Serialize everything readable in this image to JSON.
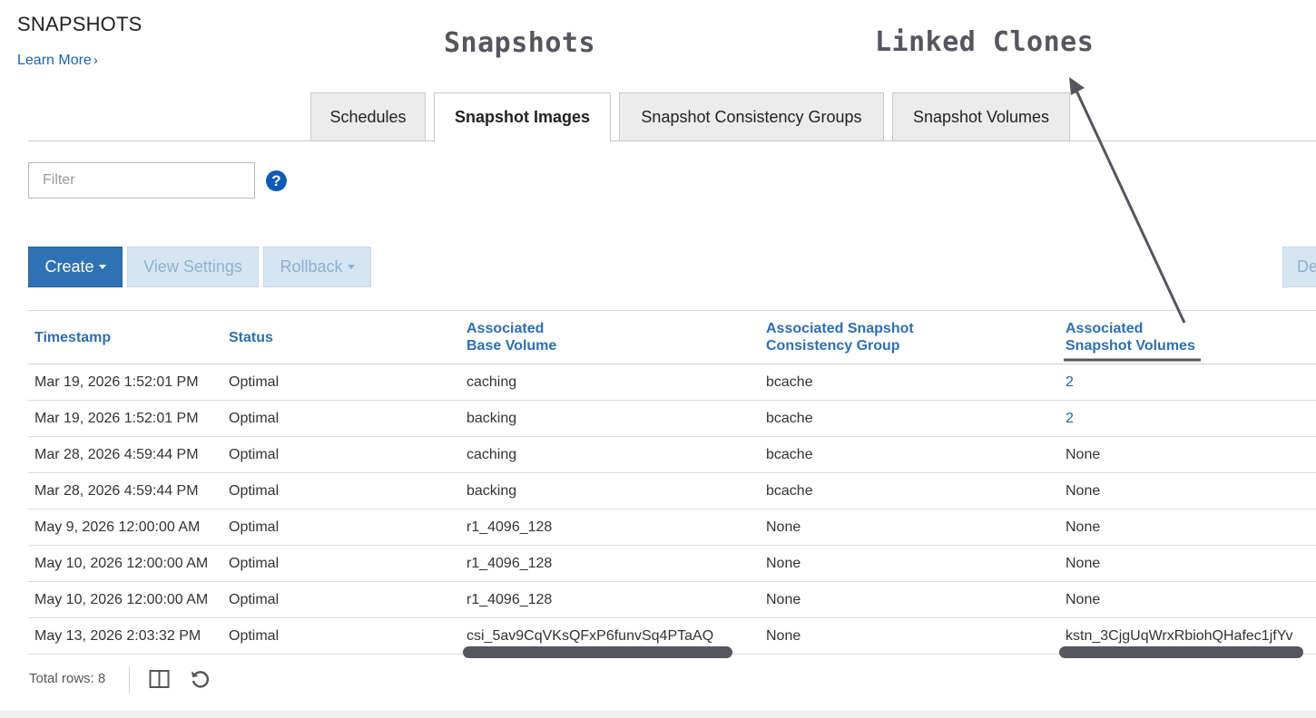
{
  "page": {
    "title": "SNAPSHOTS",
    "learn_more": "Learn More",
    "learn_more_chevron": "›"
  },
  "annotations": {
    "snapshots": "Snapshots",
    "linked_clones": "Linked Clones"
  },
  "tabs": [
    {
      "label": "Schedules",
      "active": false
    },
    {
      "label": "Snapshot Images",
      "active": true
    },
    {
      "label": "Snapshot Consistency Groups",
      "active": false
    },
    {
      "label": "Snapshot Volumes",
      "active": false
    }
  ],
  "filter": {
    "placeholder": "Filter",
    "help_icon": "?"
  },
  "toolbar": {
    "create": "Create",
    "view_settings": "View Settings",
    "rollback": "Rollback",
    "delete_partial": "De"
  },
  "table": {
    "columns": [
      {
        "line1": "Timestamp",
        "line2": ""
      },
      {
        "line1": "Status",
        "line2": ""
      },
      {
        "line1": "Associated",
        "line2": "Base Volume"
      },
      {
        "line1": "Associated Snapshot",
        "line2": "Consistency Group"
      },
      {
        "line1": "Associated",
        "line2": "Snapshot Volumes"
      }
    ],
    "rows": [
      {
        "timestamp": "Mar 19, 2026 1:52:01 PM",
        "status": "Optimal",
        "base_volume": "caching",
        "consistency_group": "bcache",
        "snapshot_volumes": "2"
      },
      {
        "timestamp": "Mar 19, 2026 1:52:01 PM",
        "status": "Optimal",
        "base_volume": "backing",
        "consistency_group": "bcache",
        "snapshot_volumes": "2"
      },
      {
        "timestamp": "Mar 28, 2026 4:59:44 PM",
        "status": "Optimal",
        "base_volume": "caching",
        "consistency_group": "bcache",
        "snapshot_volumes": "None"
      },
      {
        "timestamp": "Mar 28, 2026 4:59:44 PM",
        "status": "Optimal",
        "base_volume": "backing",
        "consistency_group": "bcache",
        "snapshot_volumes": "None"
      },
      {
        "timestamp": "May 9, 2026 12:00:00 AM",
        "status": "Optimal",
        "base_volume": "r1_4096_128",
        "consistency_group": "None",
        "snapshot_volumes": "None"
      },
      {
        "timestamp": "May 10, 2026 12:00:00 AM",
        "status": "Optimal",
        "base_volume": "r1_4096_128",
        "consistency_group": "None",
        "snapshot_volumes": "None"
      },
      {
        "timestamp": "May 10, 2026 12:00:00 AM",
        "status": "Optimal",
        "base_volume": "r1_4096_128",
        "consistency_group": "None",
        "snapshot_volumes": "None"
      },
      {
        "timestamp": "May 13, 2026 2:03:32 PM",
        "status": "Optimal",
        "base_volume": "csi_5av9CqVKsQFxP6funvSq4PTaAQ",
        "consistency_group": "None",
        "snapshot_volumes": "kstn_3CjgUqWrxRbiohQHafec1jfYv"
      }
    ]
  },
  "footer": {
    "total_rows": "Total rows: 8",
    "columns_icon": "columns-icon",
    "refresh_icon": "refresh-icon"
  },
  "colors": {
    "link": "#1a63b0",
    "primary_button": "#2e72b3",
    "annotation": "#55565e"
  }
}
